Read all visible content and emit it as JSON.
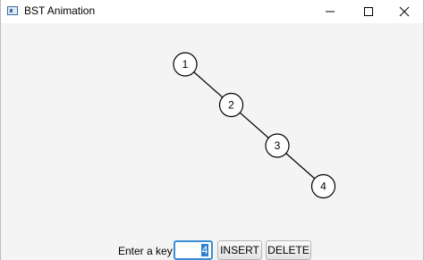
{
  "window": {
    "title": "BST Animation",
    "icon": "app-window-icon"
  },
  "tree": {
    "nodes": [
      {
        "key": "1",
        "depth": 0,
        "order": 0
      },
      {
        "key": "2",
        "depth": 1,
        "order": 1
      },
      {
        "key": "3",
        "depth": 2,
        "order": 2
      },
      {
        "key": "4",
        "depth": 3,
        "order": 3
      }
    ],
    "edges": [
      {
        "from": "1",
        "to": "2"
      },
      {
        "from": "2",
        "to": "3"
      },
      {
        "from": "3",
        "to": "4"
      }
    ]
  },
  "controls": {
    "key_label": "Enter a key:",
    "key_value": "4",
    "insert_label": "INSERT",
    "delete_label": "DELETE"
  },
  "colors": {
    "canvas_bg": "#f4f4f4",
    "node_fill": "#ffffff",
    "node_stroke": "#000000",
    "edge": "#000000",
    "input_focus": "#3a8ed6"
  }
}
